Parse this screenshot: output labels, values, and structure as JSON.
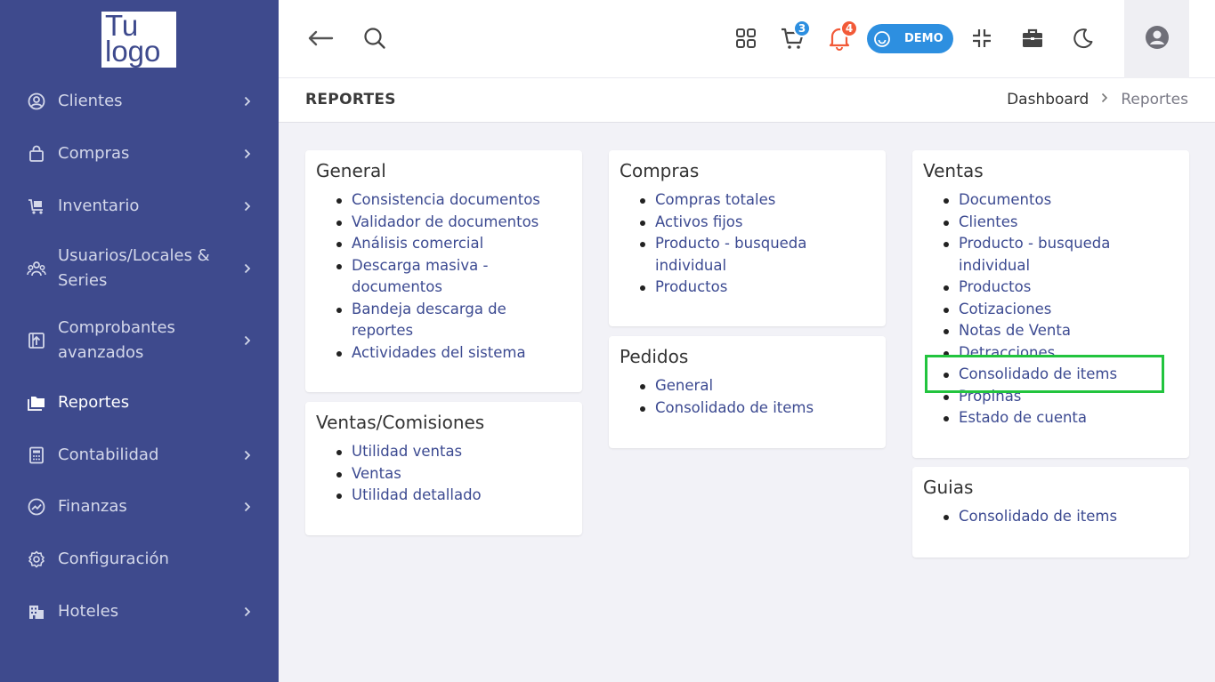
{
  "logo": {
    "line1": "Tu",
    "line2": "logo"
  },
  "sidebar": {
    "items": [
      {
        "label": "Clientes",
        "icon": "user-circle-icon"
      },
      {
        "label": "Compras",
        "icon": "shopping-bag-icon"
      },
      {
        "label": "Inventario",
        "icon": "cart-dolly-icon"
      },
      {
        "label": "Usuarios/Locales & Series",
        "icon": "users-icon"
      },
      {
        "label": "Comprobantes avanzados",
        "icon": "document-upload-icon"
      },
      {
        "label": "Reportes",
        "icon": "folders-icon"
      },
      {
        "label": "Contabilidad",
        "icon": "calculator-icon"
      },
      {
        "label": "Finanzas",
        "icon": "trend-circle-icon"
      },
      {
        "label": "Configuración",
        "icon": "gear-icon"
      },
      {
        "label": "Hoteles",
        "icon": "building-icon"
      }
    ],
    "active": "Reportes"
  },
  "topbar": {
    "cart_count": "3",
    "notifications_count": "4",
    "demo_label": "DEMO",
    "colors": {
      "accent": "#2d8fe0",
      "notification": "#f25a38",
      "sidebar": "#3e4a8d"
    }
  },
  "page": {
    "title": "REPORTES",
    "breadcrumb": {
      "home": "Dashboard",
      "current": "Reportes"
    }
  },
  "cards": {
    "general": {
      "title": "General",
      "items": [
        "Consistencia documentos",
        "Validador de documentos",
        "Análisis comercial",
        "Descarga masiva - documentos",
        "Bandeja descarga de reportes",
        "Actividades del sistema"
      ]
    },
    "ventas_comisiones": {
      "title": "Ventas/Comisiones",
      "items": [
        "Utilidad ventas",
        "Ventas",
        "Utilidad detallado"
      ]
    },
    "compras": {
      "title": "Compras",
      "items": [
        "Compras totales",
        "Activos fijos",
        "Producto - busqueda individual",
        "Productos"
      ]
    },
    "pedidos": {
      "title": "Pedidos",
      "items": [
        "General",
        "Consolidado de items"
      ]
    },
    "ventas": {
      "title": "Ventas",
      "items": [
        "Documentos",
        "Clientes",
        "Producto - busqueda individual",
        "Productos",
        "Cotizaciones",
        "Notas de Venta",
        "Detracciones",
        "Consolidado de items",
        "Propinas",
        "Estado de cuenta"
      ]
    },
    "guias": {
      "title": "Guias",
      "items": [
        "Consolidado de items"
      ]
    }
  }
}
